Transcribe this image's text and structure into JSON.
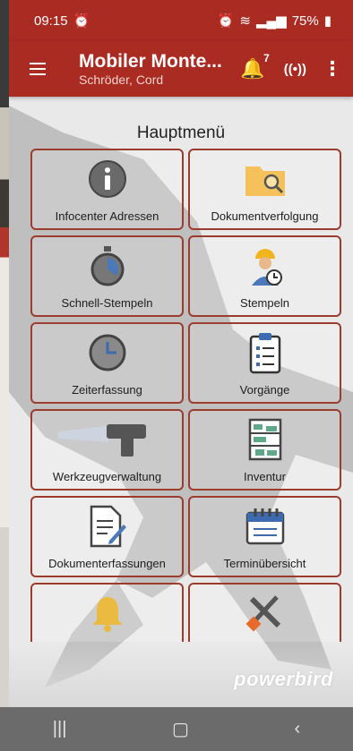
{
  "status": {
    "time": "09:15",
    "battery": "75%"
  },
  "appbar": {
    "title": "Mobiler Monte...",
    "subtitle": "Schröder, Cord",
    "notification_count": "7"
  },
  "main": {
    "heading": "Hauptmenü",
    "tiles": [
      {
        "label": "Infocenter Adressen",
        "icon": "info-icon"
      },
      {
        "label": "Dokumentverfolgung",
        "icon": "folder-search-icon"
      },
      {
        "label": "Schnell-Stempeln",
        "icon": "stopwatch-icon"
      },
      {
        "label": "Stempeln",
        "icon": "worker-clock-icon"
      },
      {
        "label": "Zeiterfassung",
        "icon": "clock-icon"
      },
      {
        "label": "Vorgänge",
        "icon": "clipboard-list-icon"
      },
      {
        "label": "Werkzeugverwaltung",
        "icon": "barcode-scanner-icon"
      },
      {
        "label": "Inventur",
        "icon": "shelf-icon"
      },
      {
        "label": "Dokumenterfassungen",
        "icon": "document-edit-icon"
      },
      {
        "label": "Terminübersicht",
        "icon": "calendar-icon"
      },
      {
        "label": "",
        "icon": "bell-icon"
      },
      {
        "label": "",
        "icon": "tools-icon"
      }
    ]
  },
  "brand": "powerbird",
  "colors": {
    "accent": "#a92b22",
    "tile_border": "#9c3c2f",
    "bell": "#f2b51d"
  }
}
